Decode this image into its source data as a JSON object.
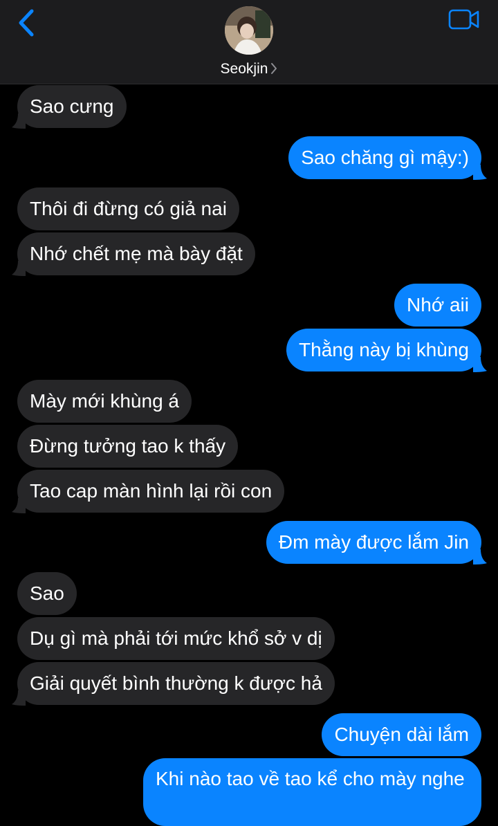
{
  "header": {
    "contact_name": "Seokjin",
    "back_icon": "chevron-left-icon",
    "video_icon": "video-camera-icon",
    "accent_color": "#0a84ff"
  },
  "messages": [
    {
      "side": "in",
      "text": "Sao cưng"
    },
    {
      "side": "out",
      "text": "Sao chăng gì mậy:)"
    },
    {
      "side": "in",
      "text": "Thôi đi đừng có giả nai"
    },
    {
      "side": "in",
      "text": "Nhớ chết mẹ mà bày đặt"
    },
    {
      "side": "out",
      "text": "Nhớ aii"
    },
    {
      "side": "out",
      "text": "Thằng này bị khùng"
    },
    {
      "side": "in",
      "text": "Mày mới khùng á"
    },
    {
      "side": "in",
      "text": "Đừng tưởng tao k thấy"
    },
    {
      "side": "in",
      "text": "Tao cap màn hình lại rồi con"
    },
    {
      "side": "out",
      "text": "Đm mày được lắm Jin"
    },
    {
      "side": "in",
      "text": "Sao"
    },
    {
      "side": "in",
      "text": "Dụ gì mà phải tới mức khổ sở v dị"
    },
    {
      "side": "in",
      "text": "Giải quyết bình thường k được hả"
    },
    {
      "side": "out",
      "text": "Chuyện dài lắm"
    },
    {
      "side": "out",
      "text": "Khi nào tao về tao kể cho mày nghe"
    }
  ]
}
